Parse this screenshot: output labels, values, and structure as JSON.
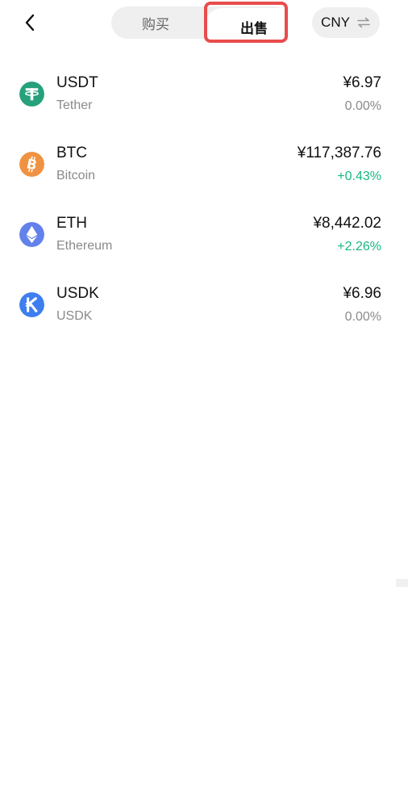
{
  "header": {
    "back_icon": "chevron-left-icon",
    "tabs": [
      {
        "label": "购买",
        "active": false
      },
      {
        "label": "出售",
        "active": true
      }
    ],
    "currency": {
      "label": "CNY",
      "icon": "swap-arrows-icon"
    }
  },
  "assets": [
    {
      "symbol": "USDT",
      "name": "Tether",
      "price": "¥6.97",
      "change": "0.00%",
      "trend": "flat",
      "icon": "tether-icon",
      "icon_color": "#26a17b"
    },
    {
      "symbol": "BTC",
      "name": "Bitcoin",
      "price": "¥117,387.76",
      "change": "+0.43%",
      "trend": "up",
      "icon": "bitcoin-icon",
      "icon_color": "#f09242"
    },
    {
      "symbol": "ETH",
      "name": "Ethereum",
      "price": "¥8,442.02",
      "change": "+2.26%",
      "trend": "up",
      "icon": "ethereum-icon",
      "icon_color": "#6281ea"
    },
    {
      "symbol": "USDK",
      "name": "USDK",
      "price": "¥6.96",
      "change": "0.00%",
      "trend": "flat",
      "icon": "usdk-icon",
      "icon_color": "#3d7ef0"
    }
  ],
  "colors": {
    "up": "#17b883",
    "flat": "#8a8a8a",
    "highlight_border": "#e84c4c"
  }
}
